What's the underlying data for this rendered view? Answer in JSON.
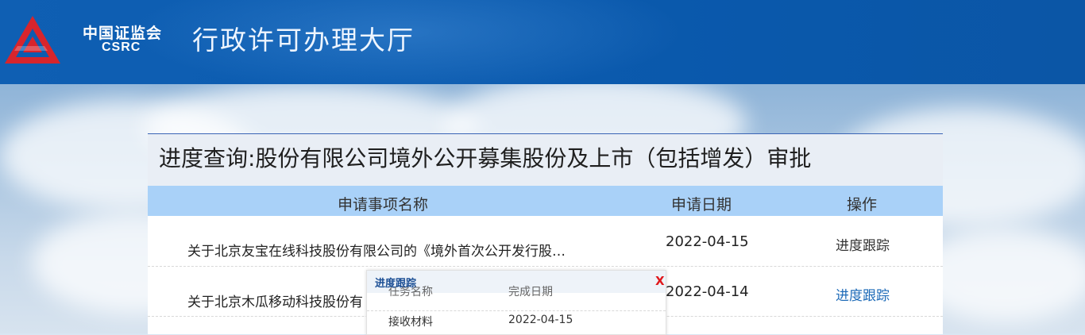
{
  "header": {
    "logo_cn": "中国证监会",
    "logo_en": "CSRC",
    "title": "行政许可办理大厅"
  },
  "panel": {
    "title": "进度查询:股份有限公司境外公开募集股份及上市（包括增发）审批",
    "columns": {
      "name": "申请事项名称",
      "date": "申请日期",
      "action": "操作"
    },
    "rows": [
      {
        "name": "关于北京友宝在线科技股份有限公司的《境外首次公开发行股…",
        "date": "2022-04-15",
        "action": "进度跟踪"
      },
      {
        "name": "关于北京木瓜移动科技股份有",
        "date": "2022-04-14",
        "action": "进度跟踪"
      }
    ]
  },
  "popup": {
    "title": "进度跟踪",
    "close": "X",
    "columns": {
      "task": "任务名称",
      "date": "完成日期"
    },
    "rows": [
      {
        "task": "接收材料",
        "date": "2022-04-15"
      }
    ]
  },
  "colors": {
    "header_blue": "#0c5cb0",
    "table_header": "#a9d1f8",
    "link": "#1e6bb8",
    "close_red": "#e0181c",
    "logo_red": "#d7252c"
  },
  "icons": {
    "logo": "csrc-logo-icon"
  }
}
